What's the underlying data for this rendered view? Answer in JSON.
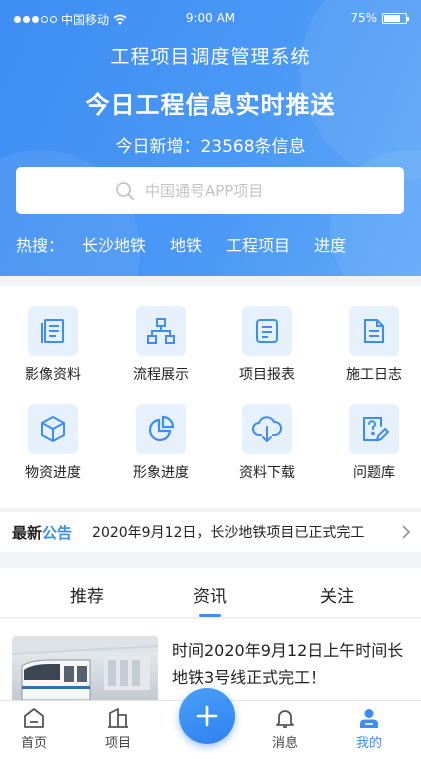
{
  "status_bar": {
    "carrier": "中国移动",
    "time": "9:00 AM",
    "battery": "75%",
    "battery_level": 0.75,
    "signal_bars_filled": 3,
    "signal_bars_total": 5
  },
  "header": {
    "app_title": "工程项目调度管理系统",
    "hero_title": "今日工程信息实时推送",
    "today_new": "今日新增：23568条信息",
    "search": {
      "placeholder": "中国通号APP项目",
      "value": ""
    },
    "hot_label": "热搜：",
    "hot_tags": [
      "长沙地铁",
      "地铁",
      "工程项目",
      "进度"
    ]
  },
  "grid": [
    {
      "label": "影像资料",
      "icon": "image-archive-icon"
    },
    {
      "label": "流程展示",
      "icon": "flowchart-icon"
    },
    {
      "label": "项目报表",
      "icon": "report-icon"
    },
    {
      "label": "施工日志",
      "icon": "construction-log-icon"
    },
    {
      "label": "物资进度",
      "icon": "cube-icon"
    },
    {
      "label": "形象进度",
      "icon": "pie-chart-icon"
    },
    {
      "label": "资料下载",
      "icon": "cloud-download-icon"
    },
    {
      "label": "问题库",
      "icon": "question-edit-icon"
    }
  ],
  "notice": {
    "label_part1": "最新",
    "label_part2": "公告",
    "text": "2020年9月12日，长沙地铁项目已正式完工"
  },
  "tabs": {
    "items": [
      "推荐",
      "资讯",
      "关注"
    ],
    "active_index": 1
  },
  "article": {
    "title": "时间2020年9月12日上午时间长地铁3号线正式完工！",
    "image": "subway-train-photo"
  },
  "bottom_nav": {
    "items": [
      "首页",
      "项目",
      "消息",
      "我的"
    ],
    "active_index": 3
  },
  "colors": {
    "brand": "#3d8df3",
    "tile_bg": "#e6f1fd",
    "page_bg": "#f2f3f5"
  }
}
